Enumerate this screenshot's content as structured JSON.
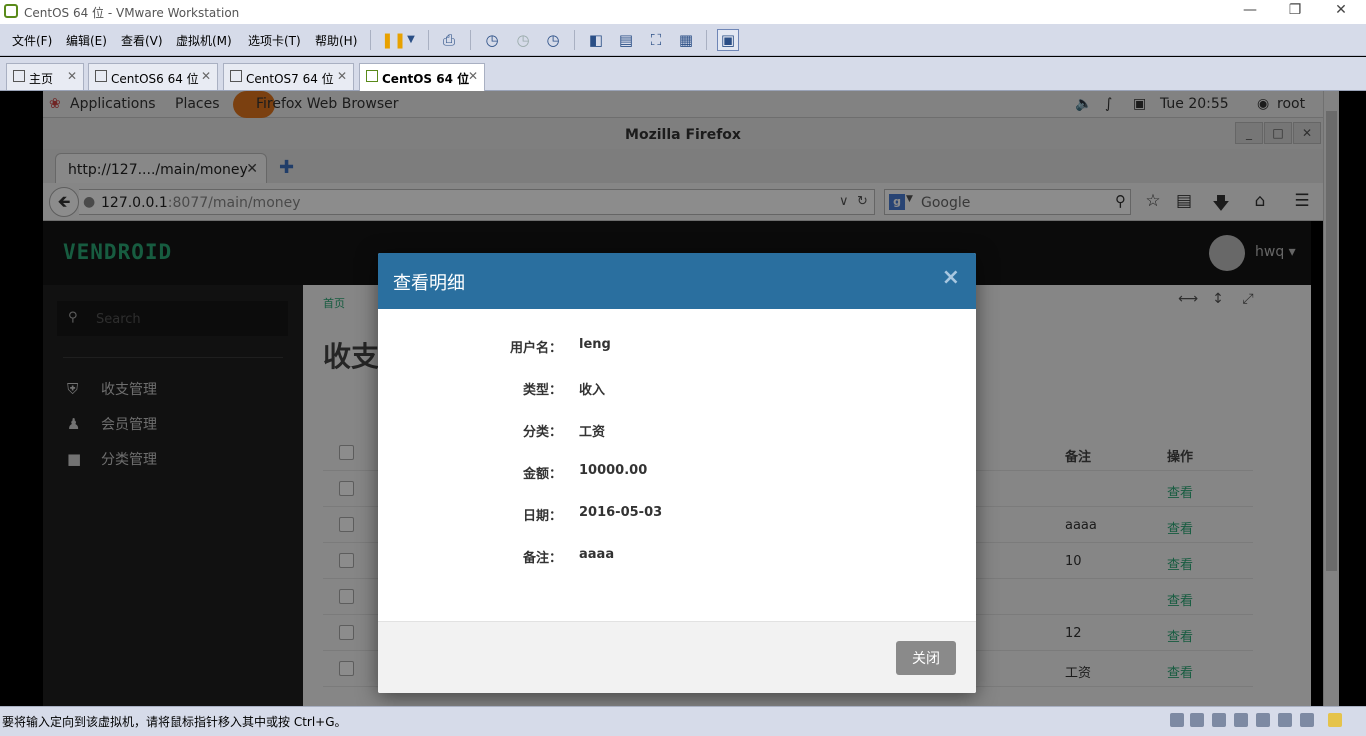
{
  "vmware": {
    "title": "CentOS 64 位 - VMware Workstation",
    "menu": [
      "文件(F)",
      "编辑(E)",
      "查看(V)",
      "虚拟机(M)",
      "选项卡(T)",
      "帮助(H)"
    ],
    "tabs": [
      {
        "label": "主页"
      },
      {
        "label": "CentOS6 64 位"
      },
      {
        "label": "CentOS7 64 位"
      },
      {
        "label": "CentOS 64 位"
      }
    ],
    "status_text": "要将输入定向到该虚拟机，请将鼠标指针移入其中或按 Ctrl+G。"
  },
  "gnome": {
    "applications": "Applications",
    "places": "Places",
    "app_name": "Firefox Web Browser",
    "clock": "Tue 20:55",
    "user": "root"
  },
  "firefox": {
    "window_title": "Mozilla Firefox",
    "tab_title": "http://127..../main/money",
    "url_host": "127.0.0.1",
    "url_rest": ":8077/main/money",
    "search_placeholder": "Google"
  },
  "app": {
    "brand": "VENDROID",
    "user": "hwq",
    "search_placeholder": "Search",
    "sidebar": [
      {
        "label": "收支管理",
        "icon": "shield-icon"
      },
      {
        "label": "会员管理",
        "icon": "user-icon"
      },
      {
        "label": "分类管理",
        "icon": "file-icon"
      }
    ],
    "breadcrumb": "首页",
    "page_title": "收支",
    "table": {
      "headers": {
        "note": "备注",
        "op": "操作"
      },
      "rows": [
        {
          "note": "",
          "op": "查看"
        },
        {
          "note": "aaaa",
          "op": "查看"
        },
        {
          "note": "10",
          "op": "查看"
        },
        {
          "note": "",
          "op": "查看"
        },
        {
          "note": "12",
          "op": "查看"
        },
        {
          "note": "工资",
          "op": "查看"
        }
      ]
    }
  },
  "modal": {
    "title": "查看明细",
    "fields": [
      {
        "label": "用户名：",
        "value": "leng"
      },
      {
        "label": "类型：",
        "value": "收入"
      },
      {
        "label": "分类：",
        "value": "工资"
      },
      {
        "label": "金额：",
        "value": "10000.00"
      },
      {
        "label": "日期：",
        "value": "2016-05-03"
      },
      {
        "label": "备注：",
        "value": "aaaa"
      }
    ],
    "close_label": "关闭"
  }
}
